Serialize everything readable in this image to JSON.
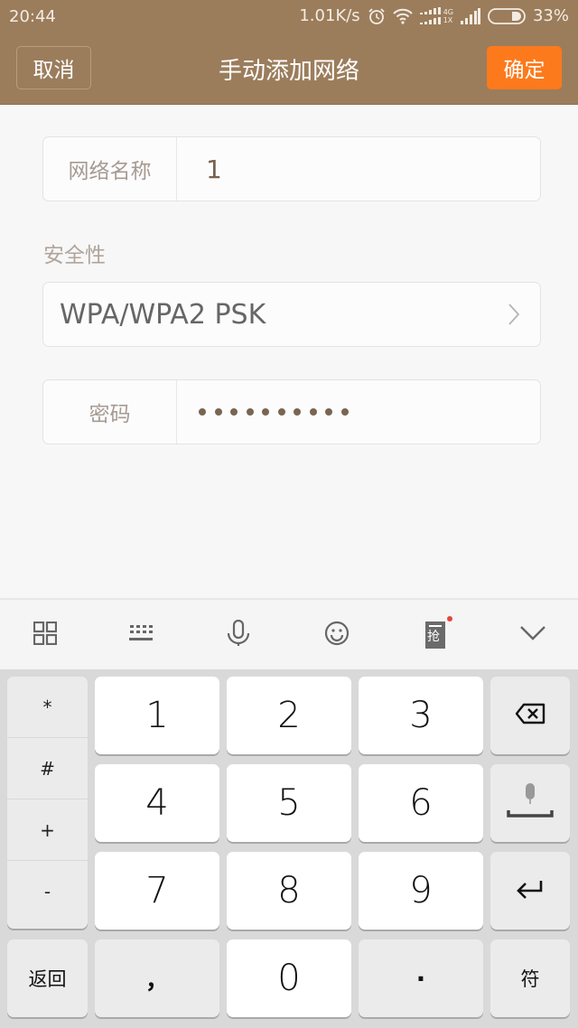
{
  "status_bar": {
    "time": "20:44",
    "net_speed": "1.01K/s",
    "net_type_top": "4G",
    "net_type_bottom": "1X",
    "battery_percent": "33%",
    "battery_level": 0.33,
    "icons": [
      "alarm-icon",
      "wifi-icon",
      "dual-signal-icon",
      "signal-icon",
      "battery-icon"
    ]
  },
  "header": {
    "cancel_label": "取消",
    "title": "手动添加网络",
    "confirm_label": "确定",
    "background_color": "#9b7d5c",
    "confirm_color": "#fc7a1c"
  },
  "form": {
    "network_name": {
      "label": "网络名称",
      "value": "1"
    },
    "security": {
      "section_label": "安全性",
      "value": "WPA/WPA2 PSK"
    },
    "password": {
      "label": "密码",
      "masked_length": 10
    }
  },
  "keyboard_toolbar": {
    "items": [
      "grid-menu-icon",
      "keyboard-icon",
      "microphone-icon",
      "emoji-icon",
      "red-envelope-icon",
      "collapse-icon"
    ],
    "red_envelope_text": "抢"
  },
  "keyboard": {
    "symbols": [
      "*",
      "#",
      "+",
      "-"
    ],
    "digits": [
      [
        "1",
        "2",
        "3"
      ],
      [
        "4",
        "5",
        "6"
      ],
      [
        "7",
        "8",
        "9"
      ]
    ],
    "bottom_row": {
      "back": "返回",
      "comma": "，",
      "zero": "0",
      "dot": "·",
      "symbols": "符"
    },
    "right_column": [
      "backspace-icon",
      "space-mic-icon",
      "enter-icon"
    ]
  }
}
